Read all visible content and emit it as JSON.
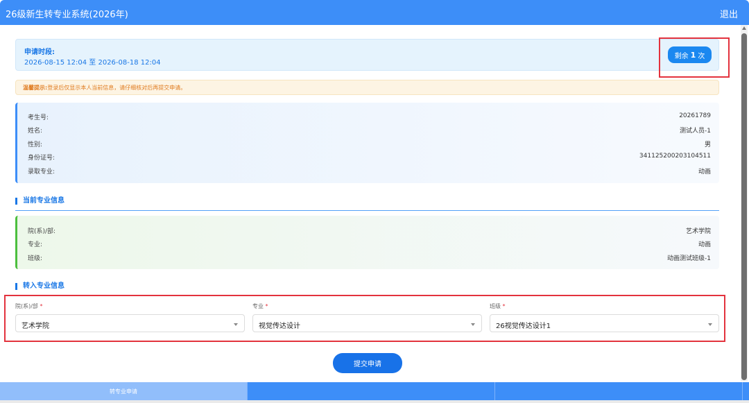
{
  "header": {
    "title": "26级新生转专业系统(2026年)",
    "logout_label": "退出"
  },
  "period": {
    "label": "申请时段:",
    "range": "2026-08-15 12:04 至 2026-08-18 12:04",
    "remain_prefix": "剩余",
    "remain_count": "1",
    "remain_suffix": "次"
  },
  "tip": {
    "title": "温馨提示:",
    "text": "登录后仅显示本人当前信息，请仔细核对后再提交申请。"
  },
  "student": {
    "rows": [
      {
        "label": "考生号:",
        "value": "20261789"
      },
      {
        "label": "姓名:",
        "value": "测试人员-1"
      },
      {
        "label": "性别:",
        "value": "男"
      },
      {
        "label": "身份证号:",
        "value": "341125200203104511"
      },
      {
        "label": "录取专业:",
        "value": "动画"
      }
    ]
  },
  "current_major": {
    "title": "当前专业信息",
    "rows": [
      {
        "label": "院(系)/部:",
        "value": "艺术学院"
      },
      {
        "label": "专业:",
        "value": "动画"
      },
      {
        "label": "班级:",
        "value": "动画测试班级-1"
      }
    ]
  },
  "transfer": {
    "title": "转入专业信息",
    "fields": [
      {
        "label": "院(系)/部",
        "required": "*",
        "value": "艺术学院"
      },
      {
        "label": "专业",
        "required": "*",
        "value": "视觉传达设计"
      },
      {
        "label": "班级",
        "required": "*",
        "value": "26视觉传达设计1"
      }
    ]
  },
  "submit_label": "提交申请",
  "bottom_nav": {
    "tabs": [
      {
        "label": "转专业申请"
      },
      {
        "label": ""
      },
      {
        "label": ""
      }
    ]
  },
  "colors": {
    "primary": "#3d8ef8",
    "accent_blue": "#1977e6",
    "green": "#4cbf3e",
    "warning": "#e07b1f",
    "highlight_red": "#e3323d"
  }
}
